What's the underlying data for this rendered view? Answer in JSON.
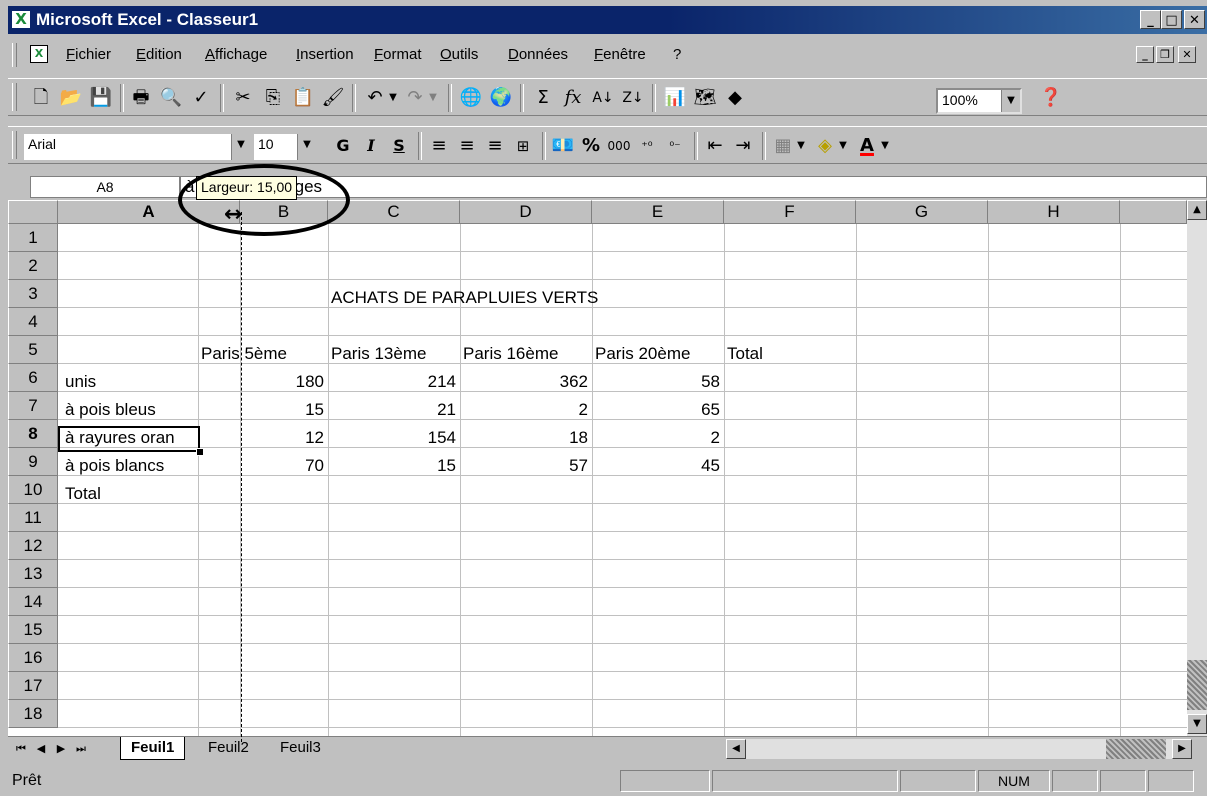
{
  "window": {
    "title": "Microsoft Excel - Classeur1",
    "controls": {
      "minimize": "_",
      "maximize": "□",
      "close": "✕",
      "restore": "❐"
    }
  },
  "menu": {
    "items": [
      "Fichier",
      "Edition",
      "Affichage",
      "Insertion",
      "Format",
      "Outils",
      "Données",
      "Fenêtre",
      "?"
    ]
  },
  "standard_toolbar": {
    "zoom": "100%"
  },
  "format_toolbar": {
    "font_name": "Arial",
    "font_size": "10",
    "bold": "G",
    "italic": "I",
    "underline": "S",
    "percent": "%",
    "thousands": "000"
  },
  "formula_bar": {
    "name_box": "A8",
    "content": "à rayures oranges",
    "tooltip": "Largeur: 15,00"
  },
  "grid": {
    "columns": [
      "A",
      "B",
      "C",
      "D",
      "E",
      "F",
      "G",
      "H"
    ],
    "active_column": "A",
    "rows": [
      "1",
      "2",
      "3",
      "4",
      "5",
      "6",
      "7",
      "8",
      "9",
      "10",
      "11",
      "12",
      "13",
      "14",
      "15",
      "16",
      "17",
      "18"
    ],
    "active_row": "8",
    "title_cell": "ACHATS DE PARAPLUIES VERTS",
    "headers": [
      "Paris 5ème",
      "Paris 13ème",
      "Paris 16ème",
      "Paris 20ème",
      "Total"
    ],
    "data_rows": [
      {
        "label": "unis",
        "values": [
          "180",
          "214",
          "362",
          "58"
        ]
      },
      {
        "label": "à pois bleus",
        "values": [
          "15",
          "21",
          "2",
          "65"
        ]
      },
      {
        "label": "à rayures oran",
        "values": [
          "12",
          "154",
          "18",
          "2"
        ]
      },
      {
        "label": "à pois blancs",
        "values": [
          "70",
          "15",
          "57",
          "45"
        ]
      }
    ],
    "total_label": "Total"
  },
  "sheets": {
    "tabs": [
      "Feuil1",
      "Feuil2",
      "Feuil3"
    ],
    "active": "Feuil1"
  },
  "status": {
    "text": "Prêt",
    "num": "NUM"
  }
}
